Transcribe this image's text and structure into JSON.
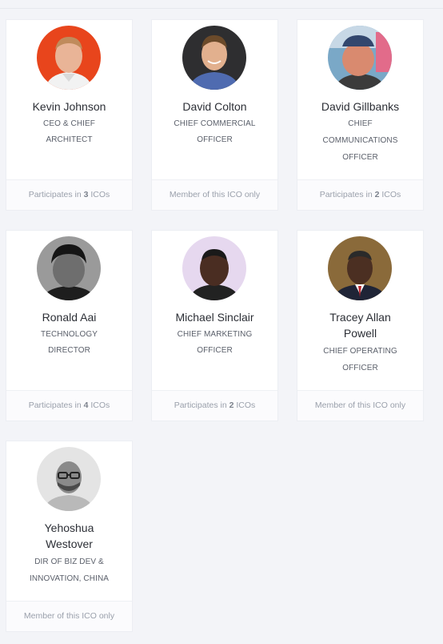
{
  "team": [
    {
      "name": "Kevin Johnson",
      "role": "CEO & CHIEF ARCHITECT",
      "footer": {
        "prefix": "Participates in",
        "count": "3",
        "suffix": "ICOs"
      },
      "avatar_bg": "#e8451c"
    },
    {
      "name": "David Colton",
      "role": "CHIEF COMMERCIAL OFFICER",
      "footer": {
        "text": "Member of this ICO only"
      },
      "avatar_bg": "#3a3a3c"
    },
    {
      "name": "David Gillbanks",
      "role": "CHIEF COMMUNICATIONS OFFICER",
      "footer": {
        "prefix": "Participates in",
        "count": "2",
        "suffix": "ICOs"
      },
      "avatar_bg": "#7aa8c7"
    },
    {
      "name": "Ronald Aai",
      "role": "TECHNOLOGY DIRECTOR",
      "footer": {
        "prefix": "Participates in",
        "count": "4",
        "suffix": "ICOs"
      },
      "avatar_bg": "#9a9a9a"
    },
    {
      "name": "Michael Sinclair",
      "role": "CHIEF MARKETING OFFICER",
      "footer": {
        "prefix": "Participates in",
        "count": "2",
        "suffix": "ICOs"
      },
      "avatar_bg": "#e6d8ef"
    },
    {
      "name": "Tracey Allan Powell",
      "role": "CHIEF OPERATING OFFICER",
      "footer": {
        "text": "Member of this ICO only"
      },
      "avatar_bg": "#8a6a3a"
    },
    {
      "name": "Yehoshua Westover",
      "role": "DIR OF BIZ DEV & INNOVATION, CHINA",
      "footer": {
        "text": "Member of this ICO only"
      },
      "avatar_bg": "#e4e4e4"
    }
  ]
}
